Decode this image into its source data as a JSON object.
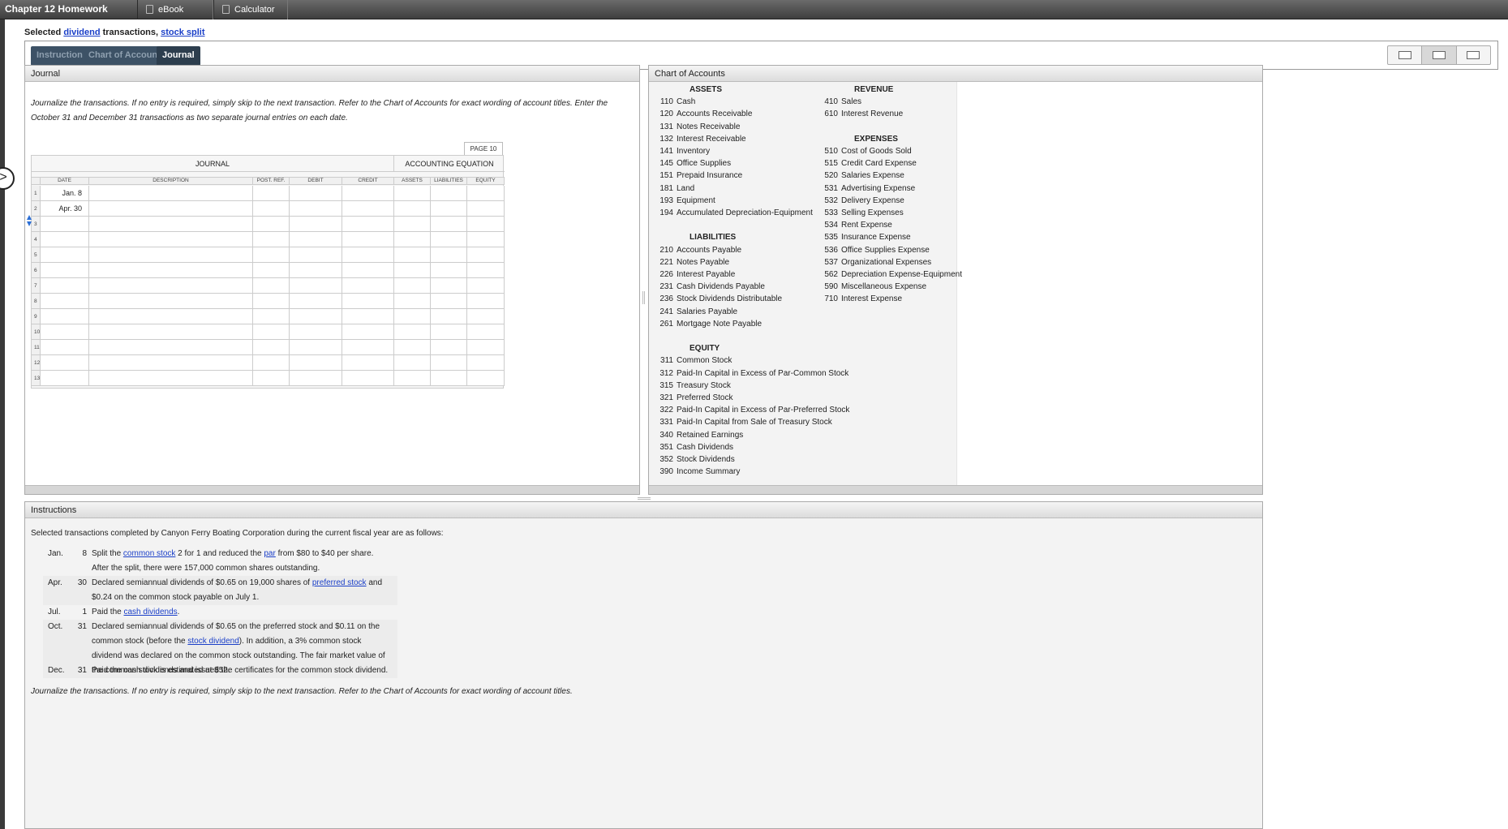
{
  "topbar": {
    "title": "Chapter 12 Homework",
    "tabs": [
      "eBook",
      "Calculator"
    ]
  },
  "subtitle": {
    "prefix": "Selected ",
    "link1": "dividend",
    "middle": " transactions, ",
    "link2": "stock split"
  },
  "tabs": [
    "Instructions",
    "Chart of Accounts",
    "Journal"
  ],
  "journal_panel": {
    "title": "Journal",
    "instructions": "Journalize the transactions. If no entry is required, simply skip to the next transaction. Refer to the Chart of Accounts for exact wording of account titles. Enter the October 31 and December 31 transactions as two separate journal entries on each date.",
    "page_label": "PAGE 10",
    "headers": {
      "journal": "JOURNAL",
      "equation": "ACCOUNTING EQUATION"
    },
    "columns": [
      "DATE",
      "DESCRIPTION",
      "POST. REF.",
      "DEBIT",
      "CREDIT",
      "ASSETS",
      "LIABILITIES",
      "EQUITY"
    ],
    "rows": [
      {
        "n": "1",
        "date": "Jan. 8"
      },
      {
        "n": "2",
        "date": "Apr. 30"
      },
      {
        "n": "3",
        "date": ""
      },
      {
        "n": "4",
        "date": ""
      },
      {
        "n": "5",
        "date": ""
      },
      {
        "n": "6",
        "date": ""
      },
      {
        "n": "7",
        "date": ""
      },
      {
        "n": "8",
        "date": ""
      },
      {
        "n": "9",
        "date": ""
      },
      {
        "n": "10",
        "date": ""
      },
      {
        "n": "11",
        "date": ""
      },
      {
        "n": "12",
        "date": ""
      },
      {
        "n": "13",
        "date": ""
      }
    ]
  },
  "coa_panel": {
    "title": "Chart of Accounts",
    "col1": [
      {
        "heading": "ASSETS",
        "items": [
          [
            "110",
            "Cash"
          ],
          [
            "120",
            "Accounts Receivable"
          ],
          [
            "131",
            "Notes Receivable"
          ],
          [
            "132",
            "Interest Receivable"
          ],
          [
            "141",
            "Inventory"
          ],
          [
            "145",
            "Office Supplies"
          ],
          [
            "151",
            "Prepaid Insurance"
          ],
          [
            "181",
            "Land"
          ],
          [
            "193",
            "Equipment"
          ],
          [
            "194",
            "Accumulated Depreciation-Equipment"
          ]
        ]
      },
      {
        "heading": "LIABILITIES",
        "items": [
          [
            "210",
            "Accounts Payable"
          ],
          [
            "221",
            "Notes Payable"
          ],
          [
            "226",
            "Interest Payable"
          ],
          [
            "231",
            "Cash Dividends Payable"
          ],
          [
            "236",
            "Stock Dividends Distributable"
          ],
          [
            "241",
            "Salaries Payable"
          ],
          [
            "261",
            "Mortgage Note Payable"
          ]
        ]
      },
      {
        "heading": "EQUITY",
        "items": [
          [
            "311",
            "Common Stock"
          ],
          [
            "312",
            "Paid-In Capital in Excess of Par-Common Stock"
          ],
          [
            "315",
            "Treasury Stock"
          ],
          [
            "321",
            "Preferred Stock"
          ],
          [
            "322",
            "Paid-In Capital in Excess of Par-Preferred Stock"
          ],
          [
            "331",
            "Paid-In Capital from Sale of Treasury Stock"
          ],
          [
            "340",
            "Retained Earnings"
          ],
          [
            "351",
            "Cash Dividends"
          ],
          [
            "352",
            "Stock Dividends"
          ],
          [
            "390",
            "Income Summary"
          ]
        ]
      }
    ],
    "col2": [
      {
        "heading": "REVENUE",
        "items": [
          [
            "410",
            "Sales"
          ],
          [
            "610",
            "Interest Revenue"
          ]
        ]
      },
      {
        "heading": "EXPENSES",
        "items": [
          [
            "510",
            "Cost of Goods Sold"
          ],
          [
            "515",
            "Credit Card Expense"
          ],
          [
            "520",
            "Salaries Expense"
          ],
          [
            "531",
            "Advertising Expense"
          ],
          [
            "532",
            "Delivery Expense"
          ],
          [
            "533",
            "Selling Expenses"
          ],
          [
            "534",
            "Rent Expense"
          ],
          [
            "535",
            "Insurance Expense"
          ],
          [
            "536",
            "Office Supplies Expense"
          ],
          [
            "537",
            "Organizational Expenses"
          ],
          [
            "562",
            "Depreciation Expense-Equipment"
          ],
          [
            "590",
            "Miscellaneous Expense"
          ],
          [
            "710",
            "Interest Expense"
          ]
        ]
      }
    ]
  },
  "instructions_panel": {
    "title": "Instructions",
    "intro": "Selected transactions completed by Canyon Ferry Boating Corporation during the current fiscal year are as follows:",
    "transactions": [
      {
        "month": "Jan.",
        "day": "8",
        "parts": [
          "Split the ",
          {
            "link": "common stock"
          },
          " 2 for 1 and reduced the ",
          {
            "link": "par"
          },
          " from $80 to $40 per share. After the split, there were 157,000 common shares outstanding."
        ]
      },
      {
        "month": "Apr.",
        "day": "30",
        "parts": [
          "Declared semiannual dividends of $0.65 on 19,000 shares of ",
          {
            "link": "preferred stock"
          },
          " and $0.24 on the common stock payable on July 1."
        ]
      },
      {
        "month": "Jul.",
        "day": "1",
        "parts": [
          "Paid the ",
          {
            "link": "cash dividends"
          },
          "."
        ]
      },
      {
        "month": "Oct.",
        "day": "31",
        "parts": [
          "Declared semiannual dividends of $0.65 on the preferred stock and $0.11 on the common stock (before the ",
          {
            "link": "stock dividend"
          },
          "). In addition, a 3% common stock dividend was declared on the common stock outstanding. The fair market value of the common stock is estimated at $52."
        ]
      },
      {
        "month": "Dec.",
        "day": "31",
        "parts": [
          "Paid the cash dividends and issued the certificates for the common stock dividend."
        ]
      }
    ],
    "footer": "Journalize the transactions. If no entry is required, simply skip to the next transaction. Refer to the Chart of Accounts for exact wording of account titles."
  }
}
